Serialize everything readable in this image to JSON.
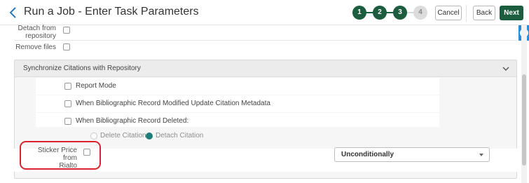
{
  "header": {
    "title": "Run a Job - Enter Task Parameters",
    "steps": [
      {
        "number": "1",
        "state": "done"
      },
      {
        "number": "2",
        "state": "done"
      },
      {
        "number": "3",
        "state": "done"
      },
      {
        "number": "4",
        "state": "pending"
      }
    ],
    "cancel_label": "Cancel",
    "back_label": "Back",
    "next_label": "Next",
    "accent_color": "#1c5c3f"
  },
  "side_panel": {
    "info_icon": "i"
  },
  "form": {
    "detach_label": "Detach from repository",
    "remove_files_label": "Remove files"
  },
  "section": {
    "title": "Synchronize Citations with Repository",
    "options": [
      {
        "label": "Report Mode",
        "checked": false
      },
      {
        "label": "When Bibliographic Record Modified Update Citation Metadata",
        "checked": false
      },
      {
        "label": "When Bibliographic Record Deleted:",
        "checked": false
      }
    ],
    "radios": [
      {
        "label": "Delete Citation",
        "selected": false
      },
      {
        "label": "Detach Citation",
        "selected": true
      }
    ]
  },
  "sticker": {
    "label_line1": "Sticker Price from",
    "label_line2": "Rialto",
    "checked": false,
    "select_value": "Unconditionally",
    "highlight_color": "#d9232e"
  }
}
